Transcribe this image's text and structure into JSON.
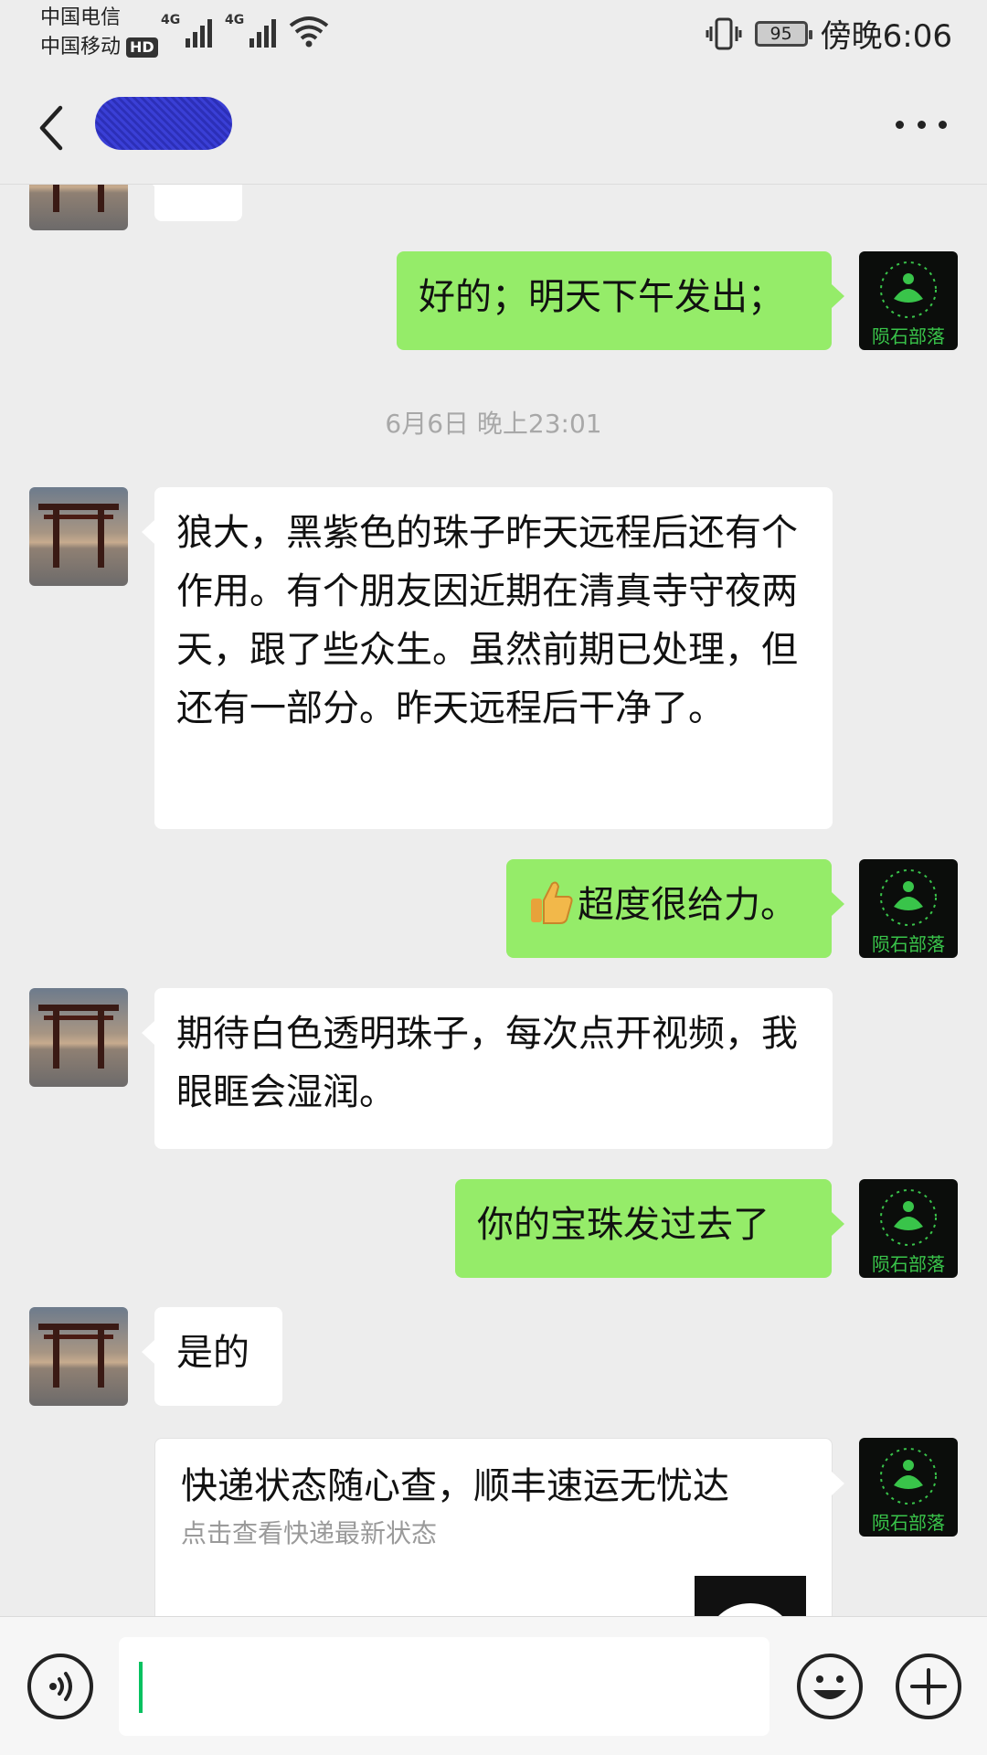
{
  "status_bar": {
    "carrier_1": "中国电信",
    "carrier_2": "中国移动",
    "hd_badge": "HD",
    "network_1": "4G",
    "network_2": "4G",
    "battery": "95",
    "time": "傍晚6:06"
  },
  "header": {
    "contact_name": "",
    "back_icon": "chevron-left-icon",
    "more_icon": "more-dots-icon"
  },
  "messages": [
    {
      "side": "right",
      "avatar": "brand-logo",
      "text": "好的；明天下午发出；"
    },
    {
      "type": "timestamp",
      "text": "6月6日 晚上23:01"
    },
    {
      "side": "left",
      "avatar": "torii",
      "text": "狼大，黑紫色的珠子昨天远程后还有个作用。有个朋友因近期在清真寺守夜两天，跟了些众生。虽然前期已处理，但还有一部分。昨天远程后干净了。"
    },
    {
      "side": "right",
      "avatar": "brand-logo",
      "icon": "thumbs-up-emoji",
      "text": "超度很给力。"
    },
    {
      "side": "left",
      "avatar": "torii",
      "text": "期待白色透明珠子，每次点开视频，我眼眶会湿润。"
    },
    {
      "side": "right",
      "avatar": "brand-logo",
      "text": "你的宝珠发过去了"
    },
    {
      "side": "left",
      "avatar": "torii",
      "text": "是的"
    },
    {
      "side": "right",
      "avatar": "brand-logo",
      "type": "card",
      "title": "快递状态随心查，顺丰速运无忧达",
      "description": "点击查看快递最新状态"
    }
  ],
  "brand_logo_text": "陨石部落",
  "input_bar": {
    "value": "",
    "voice_icon": "voice-icon",
    "emoji_icon": "emoji-icon",
    "plus_icon": "plus-icon"
  },
  "colors": {
    "background": "#ededed",
    "sent_bubble": "#95ec69",
    "received_bubble": "#ffffff",
    "accent": "#07c160"
  }
}
